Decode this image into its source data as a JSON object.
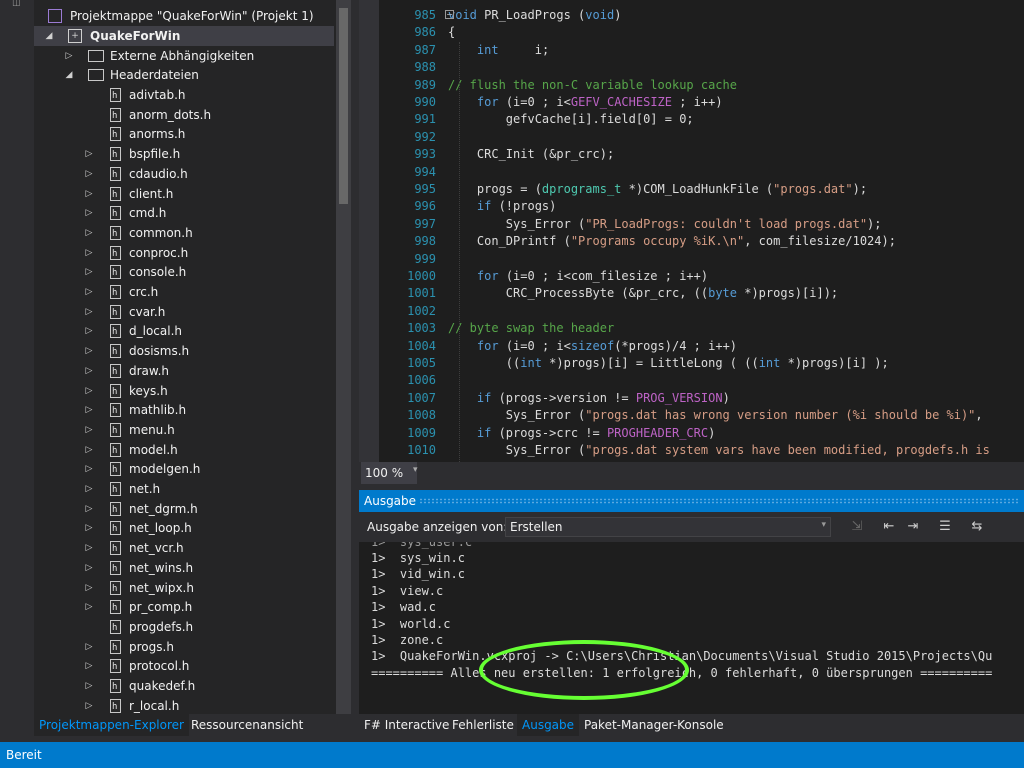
{
  "solution_explorer": {
    "solution_label": "Projektmappe \"QuakeForWin\" (Projekt 1)",
    "project_label": "QuakeForWin",
    "external_deps_label": "Externe Abhängigkeiten",
    "headers_label": "Headerdateien",
    "files": [
      "adivtab.h",
      "anorm_dots.h",
      "anorms.h",
      "bspfile.h",
      "cdaudio.h",
      "client.h",
      "cmd.h",
      "common.h",
      "conproc.h",
      "console.h",
      "crc.h",
      "cvar.h",
      "d_local.h",
      "dosisms.h",
      "draw.h",
      "keys.h",
      "mathlib.h",
      "menu.h",
      "model.h",
      "modelgen.h",
      "net.h",
      "net_dgrm.h",
      "net_loop.h",
      "net_vcr.h",
      "net_wins.h",
      "net_wipx.h",
      "pr_comp.h",
      "progdefs.h",
      "progs.h",
      "protocol.h",
      "quakedef.h",
      "r_local.h"
    ],
    "files_expandable": [
      false,
      false,
      false,
      true,
      true,
      true,
      true,
      true,
      true,
      true,
      true,
      true,
      true,
      true,
      true,
      true,
      true,
      true,
      true,
      true,
      true,
      true,
      true,
      true,
      true,
      true,
      true,
      false,
      true,
      true,
      true,
      true
    ]
  },
  "left_tabs": {
    "explorer": "Projektmappen-Explorer",
    "resources": "Ressourcenansicht"
  },
  "editor": {
    "line_numbers": [
      "985",
      "986",
      "987",
      "988",
      "989",
      "990",
      "991",
      "992",
      "993",
      "994",
      "995",
      "996",
      "997",
      "998",
      "999",
      "1000",
      "1001",
      "1002",
      "1003",
      "1004",
      "1005",
      "1006",
      "1007",
      "1008",
      "1009",
      "1010"
    ],
    "lines": [
      "void PR_LoadProgs (void)",
      "{",
      "    int     i;",
      "",
      "// flush the non-C variable lookup cache",
      "    for (i=0 ; i<GEFV_CACHESIZE ; i++)",
      "        gefvCache[i].field[0] = 0;",
      "",
      "    CRC_Init (&pr_crc);",
      "",
      "    progs = (dprograms_t *)COM_LoadHunkFile (\"progs.dat\");",
      "    if (!progs)",
      "        Sys_Error (\"PR_LoadProgs: couldn't load progs.dat\");",
      "    Con_DPrintf (\"Programs occupy %iK.\\n\", com_filesize/1024);",
      "",
      "    for (i=0 ; i<com_filesize ; i++)",
      "        CRC_ProcessByte (&pr_crc, ((byte *)progs)[i]);",
      "",
      "// byte swap the header",
      "    for (i=0 ; i<sizeof(*progs)/4 ; i++)",
      "        ((int *)progs)[i] = LittleLong ( ((int *)progs)[i] );",
      "",
      "    if (progs->version != PROG_VERSION)",
      "        Sys_Error (\"progs.dat has wrong version number (%i should be %i)\",",
      "    if (progs->crc != PROGHEADER_CRC)",
      "        Sys_Error (\"progs.dat system vars have been modified, progdefs.h is"
    ],
    "zoom": "100 %"
  },
  "output": {
    "title": "Ausgabe",
    "show_label": "Ausgabe anzeigen von:",
    "show_value": "Erstellen",
    "lines": [
      "1>  sys_win.c",
      "1>  vid_win.c",
      "1>  view.c",
      "1>  wad.c",
      "1>  world.c",
      "1>  zone.c",
      "1>  QuakeForWin.vcxproj -> C:\\Users\\Christian\\Documents\\Visual Studio 2015\\Projects\\Qu",
      "========== Alles neu erstellen: 1 erfolgreich, 0 fehlerhaft, 0 übersprungen =========="
    ]
  },
  "bottom_tabs": {
    "fsharp": "F# Interactive",
    "errors": "Fehlerliste",
    "output": "Ausgabe",
    "pkg": "Paket-Manager-Konsole"
  },
  "status": {
    "text": "Bereit",
    "accent": "#007acc",
    "highlight": "#66ff33"
  }
}
